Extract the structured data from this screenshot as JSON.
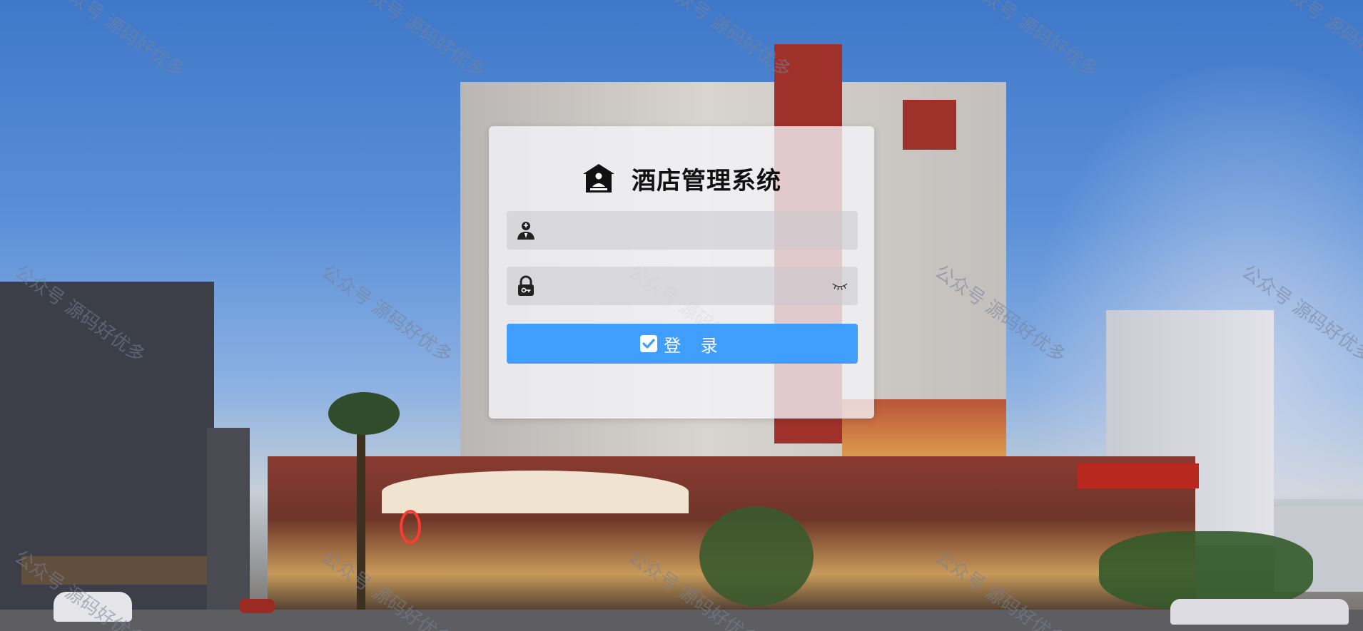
{
  "app": {
    "title": "酒店管理系统"
  },
  "login_form": {
    "username": {
      "value": "",
      "placeholder": ""
    },
    "password": {
      "value": "",
      "placeholder": ""
    },
    "login_button_label": "登 录"
  },
  "watermark": {
    "text": "公众号 源码好优多"
  },
  "icons": {
    "title": "hotel-icon",
    "username": "user-icon",
    "password": "lock-icon",
    "toggle_password": "eye-closed-icon",
    "login": "checkbox-icon"
  },
  "colors": {
    "primary_button": "#409eff",
    "card_background": "#f5f5f8",
    "title_text": "#111111"
  }
}
